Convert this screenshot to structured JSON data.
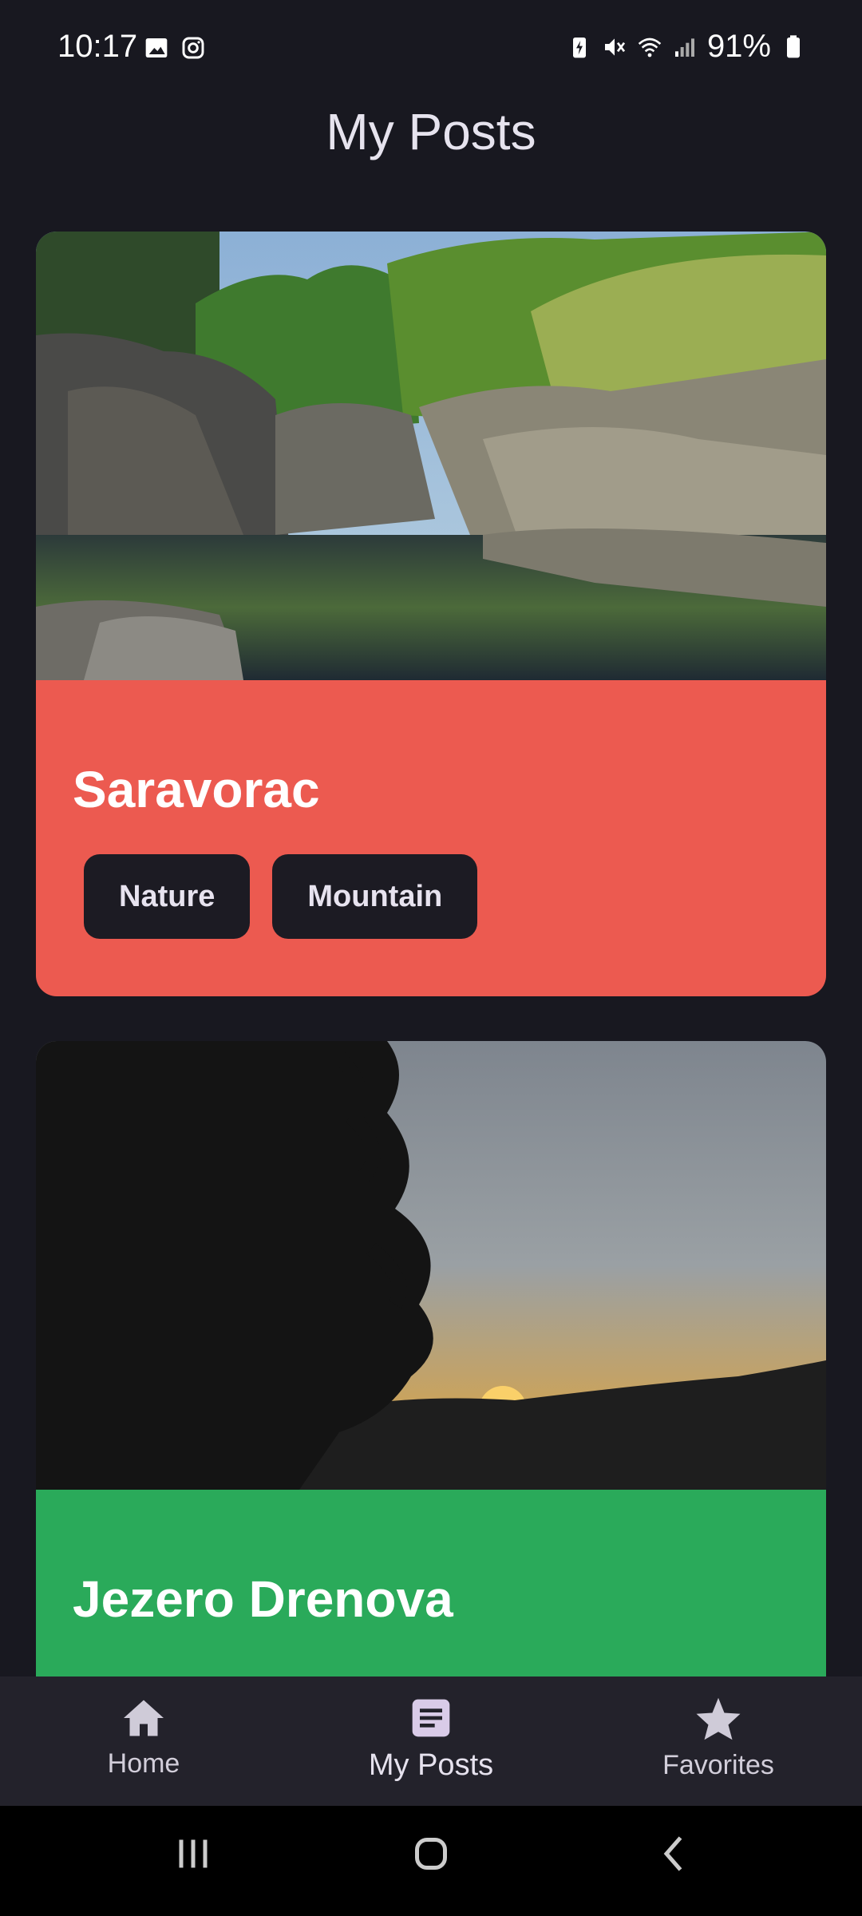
{
  "status_bar": {
    "time": "10:17",
    "battery": "91%",
    "left_icons": [
      "gallery-icon",
      "instagram-icon"
    ],
    "right_icons": [
      "battery-saver-icon",
      "mute-icon",
      "wifi-icon",
      "signal-icon",
      "battery-icon"
    ]
  },
  "header": {
    "title": "My Posts"
  },
  "posts": [
    {
      "title": "Saravorac",
      "color": "#EC5A50",
      "tags": [
        "Nature",
        "Mountain"
      ]
    },
    {
      "title": "Jezero Drenova",
      "color": "#2AAA5A",
      "tags": []
    }
  ],
  "bottom_nav": {
    "items": [
      {
        "label": "Home",
        "icon": "home-icon",
        "active": false
      },
      {
        "label": "My Posts",
        "icon": "article-icon",
        "active": true
      },
      {
        "label": "Favorites",
        "icon": "star-icon",
        "active": false
      }
    ]
  },
  "system_nav": {
    "buttons": [
      "recents-button",
      "home-button",
      "back-button"
    ]
  }
}
